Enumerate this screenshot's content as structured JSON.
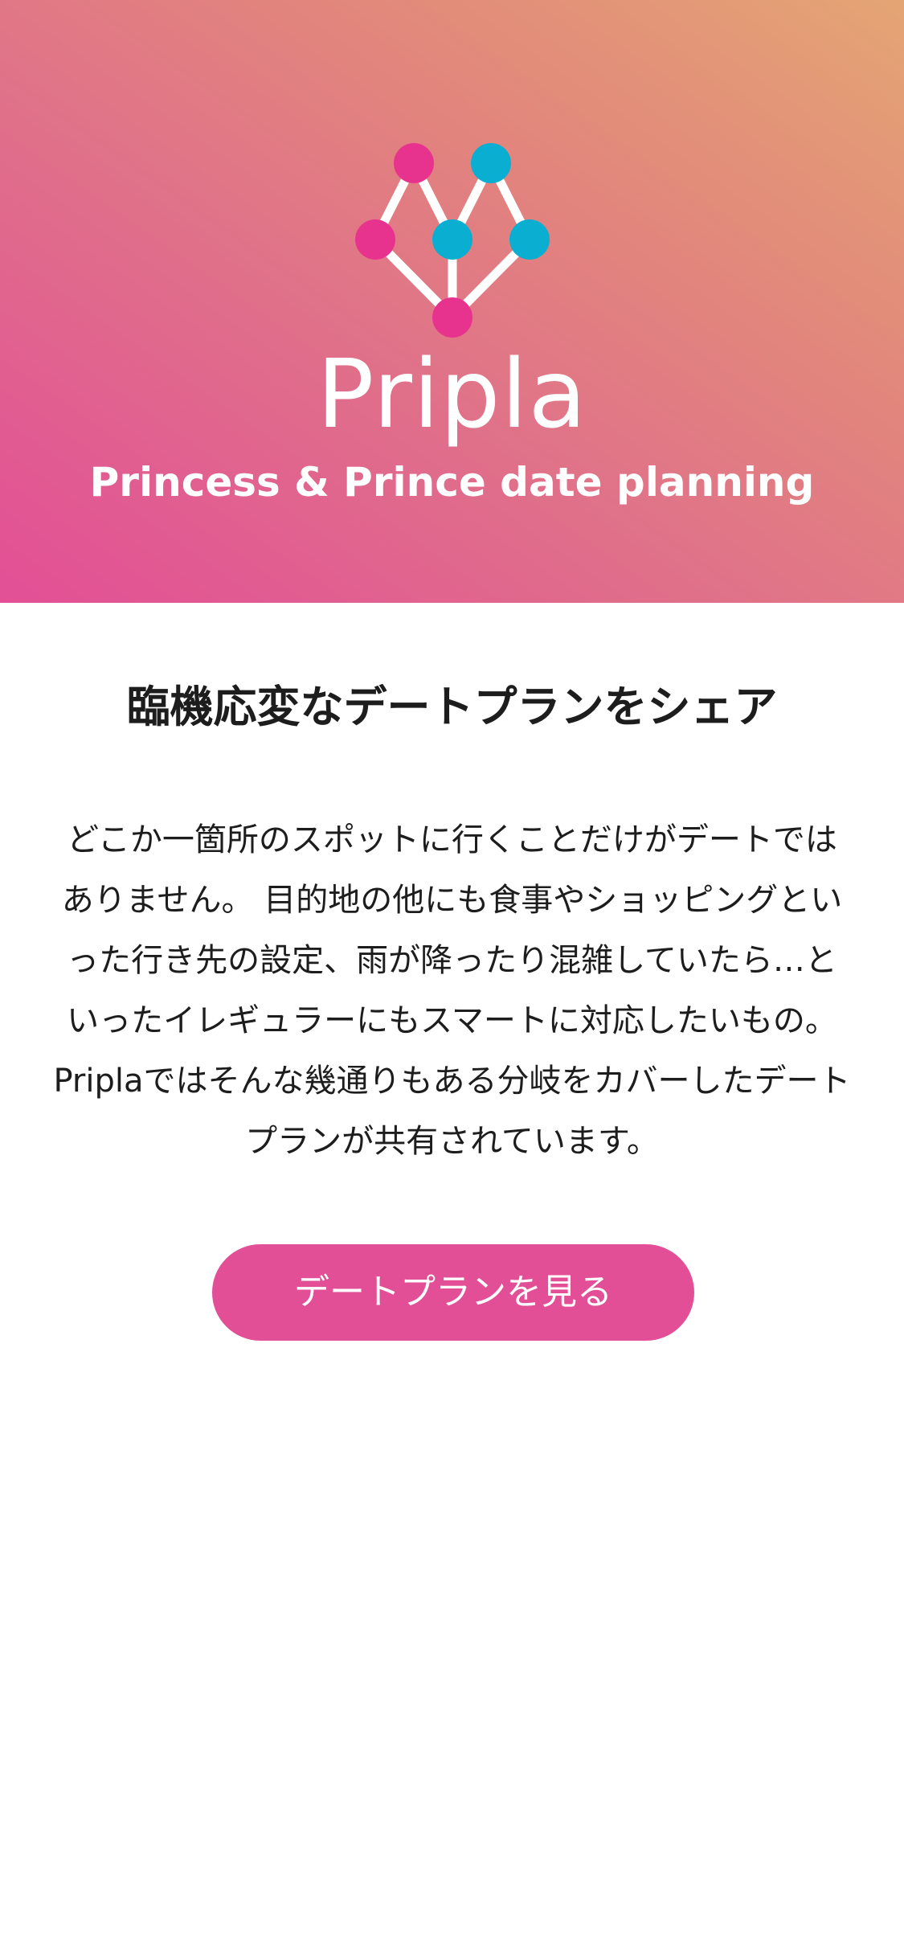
{
  "hero": {
    "brand_name": "Pripla",
    "tagline": "Princess & Prince date planning",
    "logo_icon": "heart-network-logo-icon",
    "colors": {
      "gradient_start": "#e24f96",
      "gradient_end": "#e4a574",
      "node_pink": "#e8338e",
      "node_cyan": "#0aaed0",
      "connector": "#ffffff"
    }
  },
  "main": {
    "heading": "臨機応変なデートプランをシェア",
    "description_lines": [
      "どこか一箇所のスポットに行くことだけがデートでは",
      "ありません。 目的地の他にも食事やショッピングとい",
      "った行き先の設定、雨が降ったり混雑していたら…と",
      "いったイレギュラーにもスマートに対応したいもの。",
      "Priplaではそんな幾通りもある分岐をカバーしたデート",
      "プランが共有されています。"
    ],
    "cta_label": "デートプランを見る",
    "cta_color": "#e24f96"
  }
}
